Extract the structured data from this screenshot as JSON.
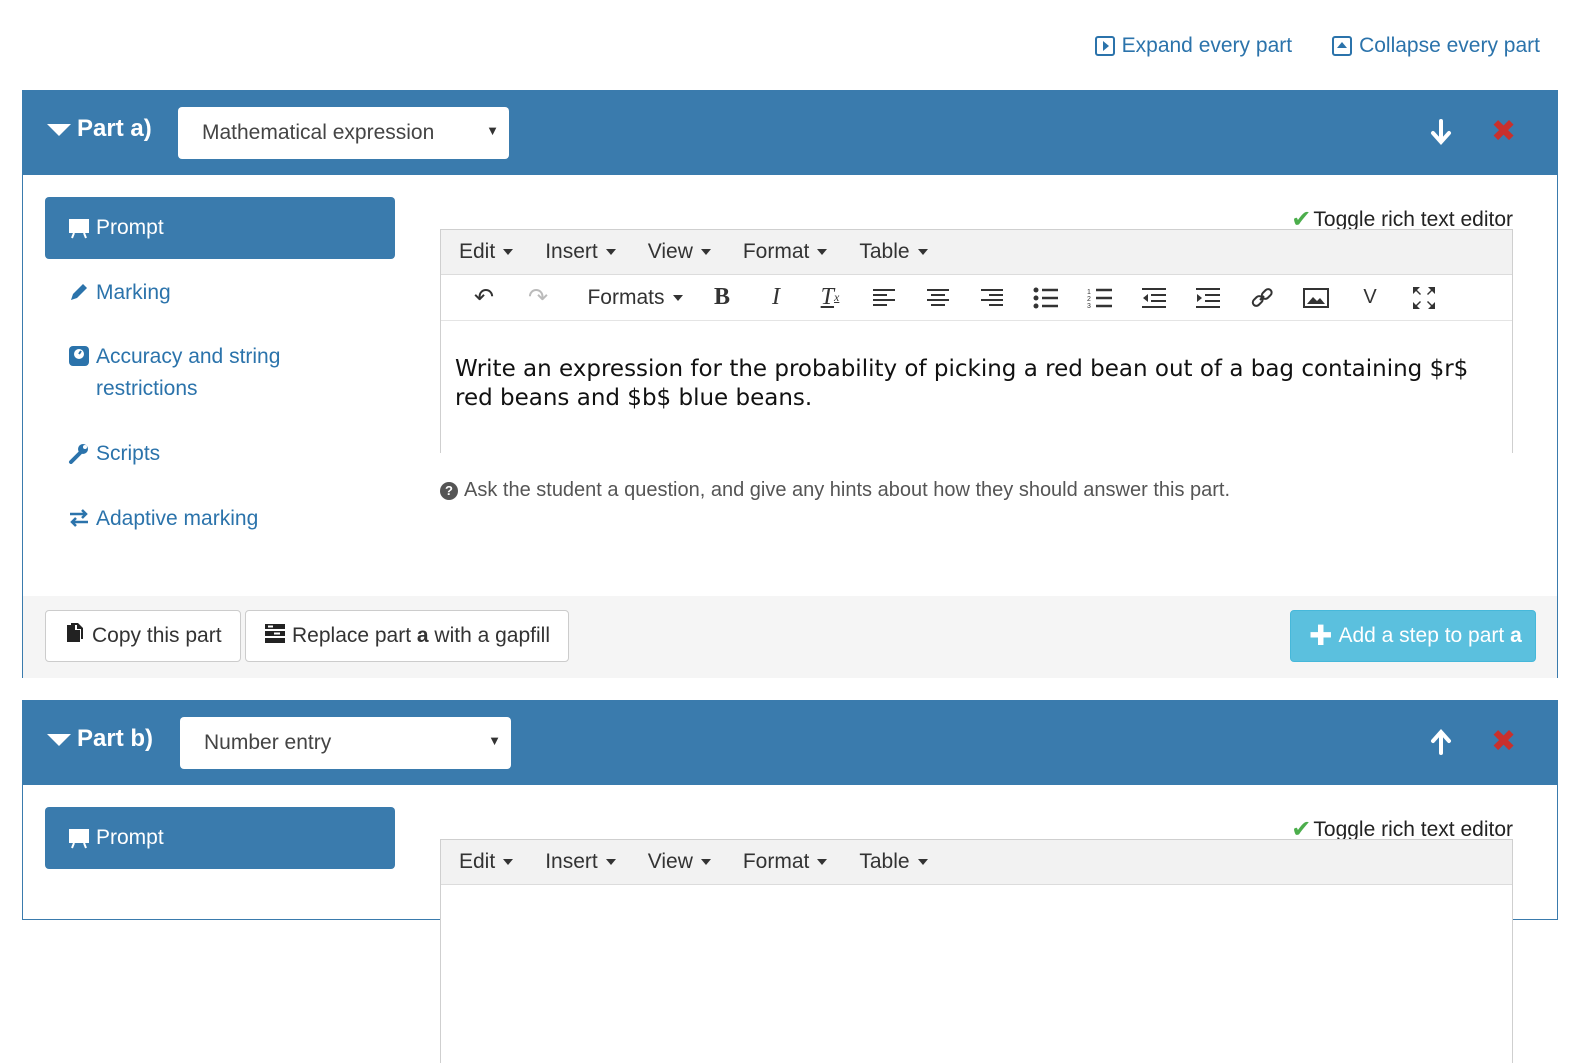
{
  "top_links": {
    "expand": "Expand every part",
    "collapse": "Collapse every part"
  },
  "parts": [
    {
      "title": "Part a)",
      "type": "Mathematical expression",
      "nav": [
        {
          "label": "Prompt",
          "icon": "presentation-icon"
        },
        {
          "label": "Marking",
          "icon": "pencil-icon"
        },
        {
          "label": "Accuracy and string restrictions",
          "icon": "scale-icon"
        },
        {
          "label": "Scripts",
          "icon": "wrench-icon"
        },
        {
          "label": "Adaptive marking",
          "icon": "swap-arrows-icon"
        }
      ],
      "toggle_rich": "Toggle rich text editor",
      "menus": [
        "Edit",
        "Insert",
        "View",
        "Format",
        "Table"
      ],
      "formats_label": "Formats",
      "prompt_text": "Write an expression for the probability of picking a red bean out of a bag containing $r$ red beans and $b$ blue beans.",
      "help_text": "Ask the student a question, and give any hints about how they should answer this part.",
      "footer": {
        "copy": "Copy this part",
        "replace_pre": "Replace part ",
        "replace_bold": "a",
        "replace_post": " with a gapfill",
        "add_pre": "Add a step to part ",
        "add_bold": "a"
      }
    },
    {
      "title": "Part b)",
      "type": "Number entry",
      "nav": [
        {
          "label": "Prompt",
          "icon": "presentation-icon"
        }
      ],
      "toggle_rich": "Toggle rich text editor",
      "menus": [
        "Edit",
        "Insert",
        "View",
        "Format",
        "Table"
      ]
    }
  ],
  "colors": {
    "header": "#3a7bad",
    "link": "#2b73ab",
    "close": "#c9302c",
    "add_button": "#5bc0de",
    "check": "#4cae4c"
  }
}
